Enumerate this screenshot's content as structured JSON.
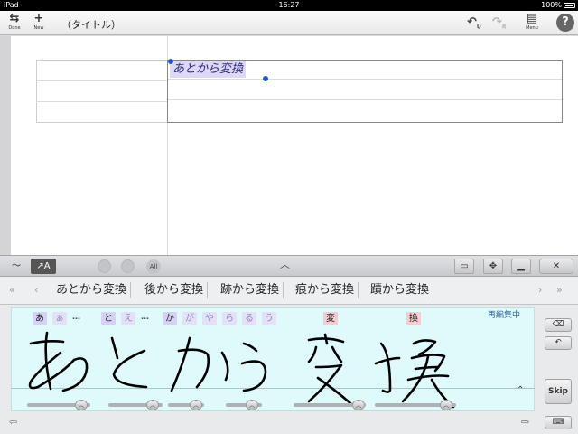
{
  "status_bar": {
    "device": "iPad",
    "time": "16:27",
    "battery": "100%"
  },
  "toolbar": {
    "done_label": "Done",
    "new_label": "New",
    "title": "（タイトル）",
    "undo_sub": "U",
    "redo_sub": "R",
    "menu_label": "Menu",
    "help_label": "?"
  },
  "document": {
    "cell_text": "あとから変換"
  },
  "panel": {
    "all_label": "All"
  },
  "candidates": [
    "あとから変換",
    "後から変換",
    "跡から変換",
    "痕から変換",
    "蹟から変換"
  ],
  "writing": {
    "status": "再編集中",
    "segments_main": [
      "あ",
      "と",
      "か",
      "変",
      "換"
    ],
    "segments_alt": [
      "ぁ",
      "え",
      "が",
      "や",
      "ら",
      "る",
      "う"
    ],
    "ellipsis": "…",
    "skip_label": "Skip"
  }
}
